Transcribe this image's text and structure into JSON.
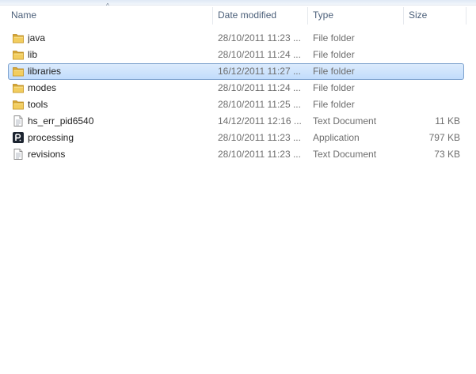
{
  "columns": {
    "name": "Name",
    "date": "Date modified",
    "type": "Type",
    "size": "Size"
  },
  "sort_indicator": "^",
  "files": [
    {
      "name": "java",
      "date": "28/10/2011 11:23 ...",
      "type": "File folder",
      "size": "",
      "icon": "folder-icon",
      "selected": false
    },
    {
      "name": "lib",
      "date": "28/10/2011 11:24 ...",
      "type": "File folder",
      "size": "",
      "icon": "folder-icon",
      "selected": false
    },
    {
      "name": "libraries",
      "date": "16/12/2011 11:27 ...",
      "type": "File folder",
      "size": "",
      "icon": "folder-icon",
      "selected": true
    },
    {
      "name": "modes",
      "date": "28/10/2011 11:24 ...",
      "type": "File folder",
      "size": "",
      "icon": "folder-icon",
      "selected": false
    },
    {
      "name": "tools",
      "date": "28/10/2011 11:25 ...",
      "type": "File folder",
      "size": "",
      "icon": "folder-icon",
      "selected": false
    },
    {
      "name": "hs_err_pid6540",
      "date": "14/12/2011 12:16 ...",
      "type": "Text Document",
      "size": "11 KB",
      "icon": "text-file-icon",
      "selected": false
    },
    {
      "name": "processing",
      "date": "28/10/2011 11:23 ...",
      "type": "Application",
      "size": "797 KB",
      "icon": "processing-app-icon",
      "selected": false
    },
    {
      "name": "revisions",
      "date": "28/10/2011 11:23 ...",
      "type": "Text Document",
      "size": "73 KB",
      "icon": "text-file-icon",
      "selected": false
    }
  ],
  "colors": {
    "selection_fill": "#c9e0fc",
    "selection_border": "#7da2ce",
    "folder": "#e8c35a",
    "header_text": "#4c607a"
  }
}
